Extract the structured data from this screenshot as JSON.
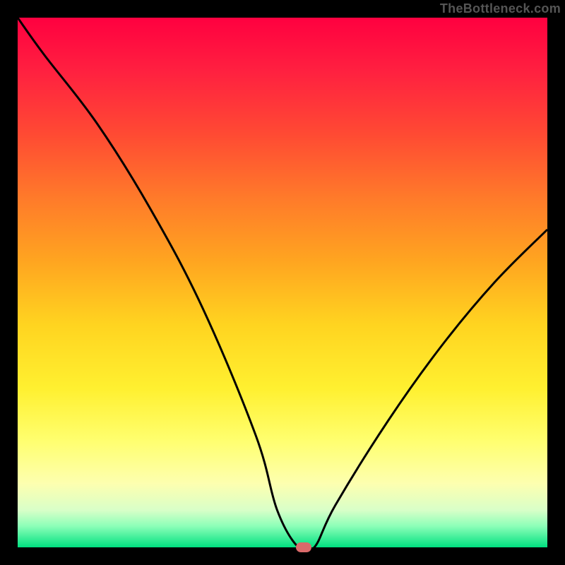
{
  "watermark": "TheBottleneck.com",
  "chart_data": {
    "type": "line",
    "title": "",
    "xlabel": "",
    "ylabel": "",
    "x": [
      0,
      5,
      15,
      25,
      35,
      45,
      49,
      53,
      56,
      60,
      70,
      80,
      90,
      100
    ],
    "values": [
      100,
      93,
      80,
      64,
      45,
      21,
      7,
      0,
      0,
      8,
      24,
      38,
      50,
      60
    ],
    "xlim": [
      0,
      100
    ],
    "ylim": [
      0,
      100
    ],
    "minimum_x": 54,
    "minimum_y": 0,
    "annotations": [],
    "legend": []
  },
  "colors": {
    "top": "#ff0040",
    "bottom": "#00e080",
    "marker": "#da6a6a",
    "curve": "#000000"
  }
}
